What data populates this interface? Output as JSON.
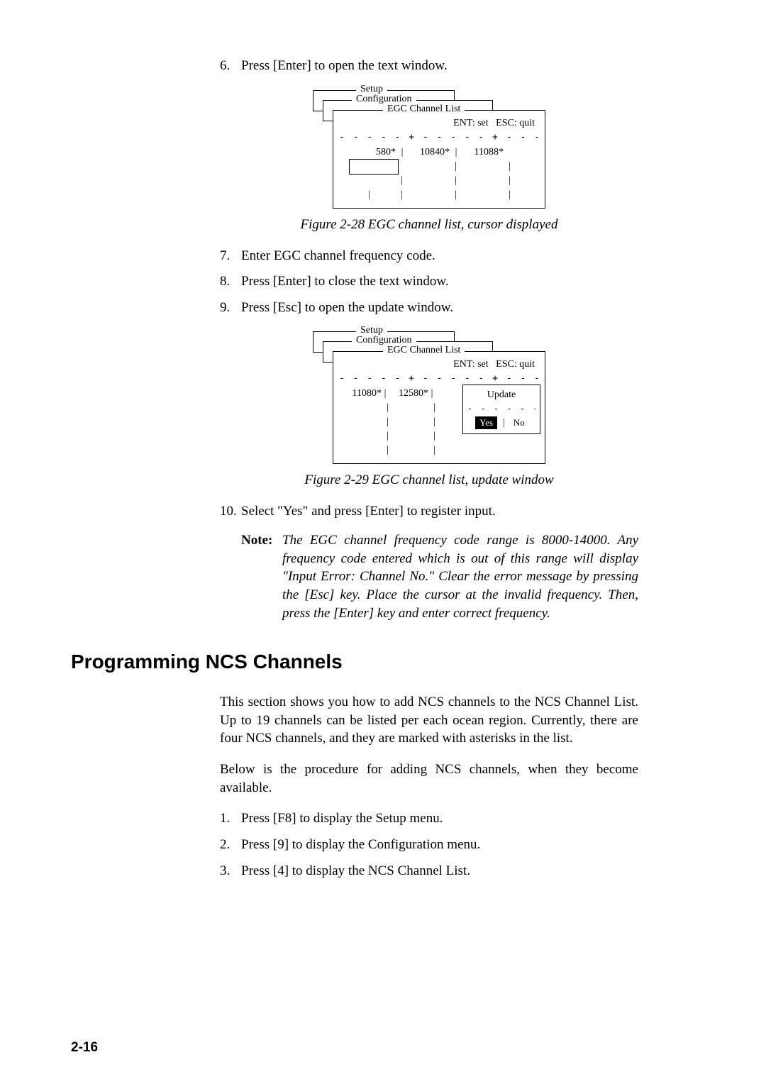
{
  "steps_a": [
    {
      "num": "6.",
      "text": "Press [Enter] to open the text window."
    }
  ],
  "diagram1": {
    "setup": "Setup",
    "config": "Configuration",
    "egc_title": "EGC Channel List",
    "hint_ent": "ENT: set",
    "hint_esc": "ESC: quit",
    "row1": [
      "580*",
      "10840*",
      "11088*"
    ]
  },
  "figure1_caption": "Figure 2-28 EGC channel list, cursor displayed",
  "steps_b": [
    {
      "num": "7.",
      "text": "Enter EGC channel frequency code."
    },
    {
      "num": "8.",
      "text": "Press [Enter] to close the text window."
    },
    {
      "num": "9.",
      "text": "Press [Esc] to open the update window."
    }
  ],
  "diagram2": {
    "setup": "Setup",
    "config": "Configuration",
    "egc_title": "EGC Channel List",
    "hint_ent": "ENT: set",
    "hint_esc": "ESC: quit",
    "row1": [
      "11080*",
      "12580*"
    ],
    "update_label": "Update",
    "yes": "Yes",
    "no": "No"
  },
  "figure2_caption": "Figure 2-29 EGC channel list, update window",
  "step10": {
    "num": "10.",
    "text": "Select \"Yes\" and press [Enter] to register input."
  },
  "note": {
    "label": "Note:",
    "text": "The EGC channel frequency code range is 8000-14000. Any frequency code entered which is out of this range will display \"Input Error: Channel No.\" Clear the error message by pressing the [Esc] key. Place the cursor at the invalid frequency. Then, press the [Enter] key and enter correct frequency."
  },
  "section_heading": "Programming NCS Channels",
  "para1": "This section shows you how to add NCS channels to the NCS Channel List. Up to 19 channels can be listed per each ocean region. Currently, there are four NCS channels, and they are marked with asterisks in the list.",
  "para2": "Below is the procedure for adding NCS channels, when they become available.",
  "steps_c": [
    {
      "num": "1.",
      "text": "Press [F8] to display the Setup menu."
    },
    {
      "num": "2.",
      "text": "Press [9] to display the Configuration menu."
    },
    {
      "num": "3.",
      "text": "Press [4] to display the NCS Channel List."
    }
  ],
  "page_number": "2-16"
}
